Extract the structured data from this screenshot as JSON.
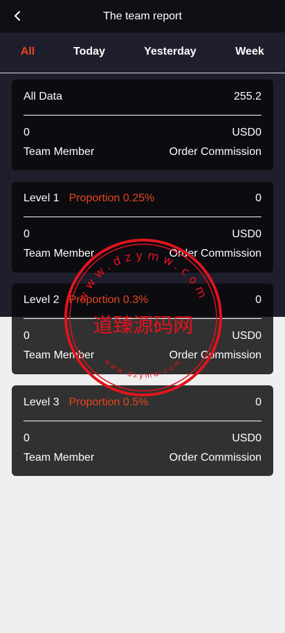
{
  "header": {
    "title": "The team report",
    "back_icon": "chevron-left-icon"
  },
  "tabs": [
    {
      "label": "All",
      "active": true
    },
    {
      "label": "Today",
      "active": false
    },
    {
      "label": "Yesterday",
      "active": false
    },
    {
      "label": "Week",
      "active": false
    }
  ],
  "summary": {
    "title": "All Data",
    "total": "255.2",
    "team_member_value": "0",
    "commission_value": "USD0",
    "team_member_label": "Team Member",
    "commission_label": "Order Commission"
  },
  "levels": [
    {
      "name": "Level 1",
      "proportion": "Proportion 0.25%",
      "count": "0",
      "team_member_value": "0",
      "commission_value": "USD0",
      "team_member_label": "Team Member",
      "commission_label": "Order Commission"
    },
    {
      "name": "Level 2",
      "proportion": "Proportion 0.3%",
      "count": "0",
      "team_member_value": "0",
      "commission_value": "USD0",
      "team_member_label": "Team Member",
      "commission_label": "Order Commission"
    },
    {
      "name": "Level 3",
      "proportion": "Proportion 0.5%",
      "count": "0",
      "team_member_value": "0",
      "commission_value": "USD0",
      "team_member_label": "Team Member",
      "commission_label": "Order Commission"
    }
  ],
  "watermark": {
    "text": "道臻源码网",
    "url": "www.dzymw.com"
  },
  "colors": {
    "accent": "#e8461e",
    "stamp": "#e0141e",
    "header_bg": "#0f0f15",
    "page_bg_top": "#1e1e2c",
    "page_bg_bottom": "#efefef"
  }
}
